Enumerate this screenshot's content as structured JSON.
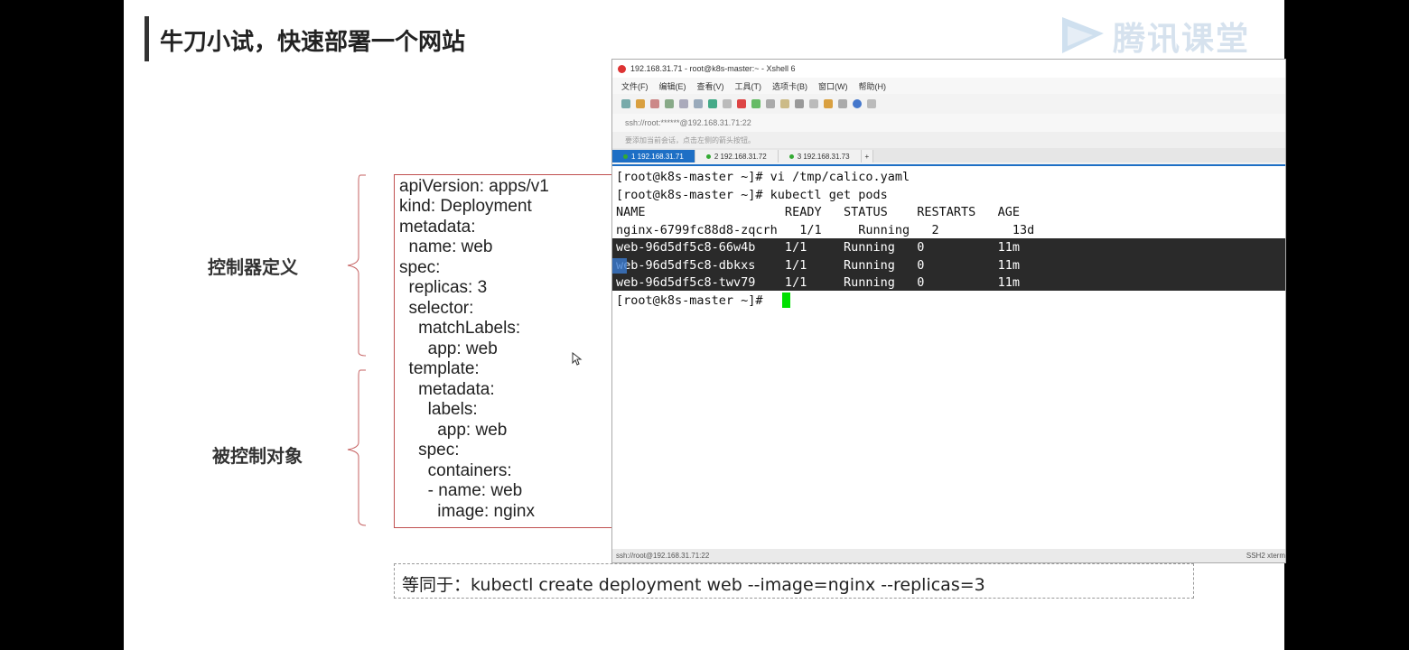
{
  "slide": {
    "title": "牛刀小试，快速部署一个网站",
    "logo_text": "腾讯课堂",
    "label_controller": "控制器定义",
    "label_controlled": "被控制对象",
    "yaml_lines": [
      "apiVersion: apps/v1",
      "kind: Deployment",
      "metadata:",
      "  name: web",
      "spec:",
      "  replicas: 3",
      "  selector:",
      "    matchLabels:",
      "      app: web",
      "  template:",
      "    metadata:",
      "      labels:",
      "        app: web",
      "    spec:",
      "      containers:",
      "      - name: web",
      "        image: nginx"
    ],
    "equivalent": "等同于：kubectl create deployment web --image=nginx --replicas=3"
  },
  "xshell": {
    "title": "192.168.31.71 - root@k8s-master:~ - Xshell 6",
    "menu": [
      "文件(F)",
      "编辑(E)",
      "查看(V)",
      "工具(T)",
      "选项卡(B)",
      "窗口(W)",
      "帮助(H)"
    ],
    "address": "ssh://root:******@192.168.31.71:22",
    "hint": "要添加当前会话，点击左侧的箭头按钮。",
    "tabs": [
      "1 192.168.31.71",
      "2 192.168.31.72",
      "3 192.168.31.73",
      "+"
    ],
    "status_left": "ssh://root@192.168.31.71:22",
    "status_right": "SSH2  xterm"
  },
  "terminal": {
    "lines": [
      "[root@k8s-master ~]# vi /tmp/calico.yaml",
      "[root@k8s-master ~]# kubectl get pods",
      "NAME                   READY   STATUS    RESTARTS   AGE",
      "nginx-6799fc88d8-zqcrh   1/1     Running   2          13d",
      "web-96d5df5c8-66w4b    1/1     Running   0          11m",
      "web-96d5df5c8-dbkxs    1/1     Running   0          11m",
      "web-96d5df5c8-twv79    1/1     Running   0          11m",
      "[root@k8s-master ~]# "
    ]
  }
}
